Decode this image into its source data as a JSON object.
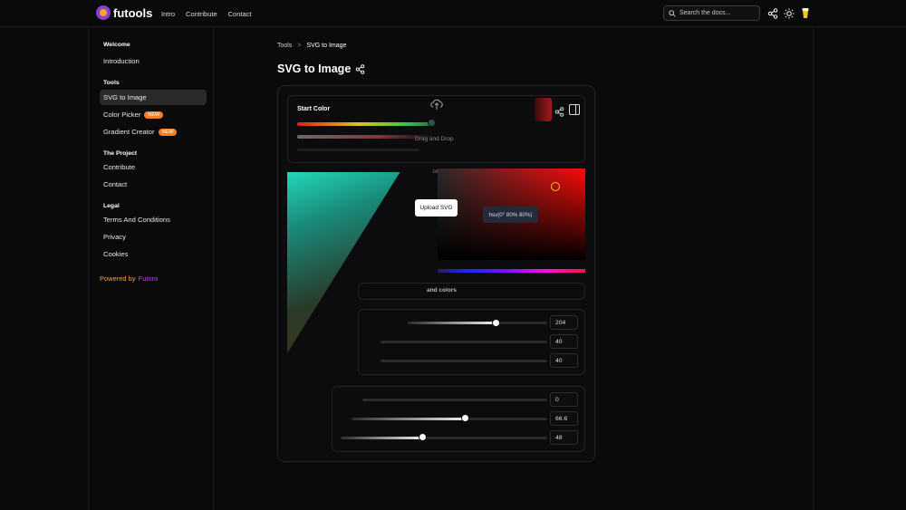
{
  "header": {
    "logo_text": "futools",
    "nav": [
      "Intro",
      "Contribute",
      "Contact"
    ],
    "search_placeholder": "Search the docs...",
    "icons": [
      "share-icon",
      "sun-icon",
      "cup-icon"
    ]
  },
  "sidebar": {
    "sections": [
      {
        "title": "Welcome",
        "items": [
          {
            "label": "Introduction"
          }
        ]
      },
      {
        "title": "Tools",
        "items": [
          {
            "label": "SVG to Image",
            "active": true
          },
          {
            "label": "Color Picker",
            "badge": "NEW"
          },
          {
            "label": "Gradient Creator",
            "badge": "NEW"
          }
        ]
      },
      {
        "title": "The Project",
        "items": [
          {
            "label": "Contribute"
          },
          {
            "label": "Contact"
          }
        ]
      },
      {
        "title": "Legal",
        "items": [
          {
            "label": "Terms And Conditions"
          },
          {
            "label": "Privacy"
          },
          {
            "label": "Cookies"
          }
        ]
      }
    ],
    "powered_prefix": "Powered by",
    "powered_brand": "Futoro"
  },
  "breadcrumb": {
    "parent": "Tools",
    "sep": ">",
    "current": "SVG to Image"
  },
  "page_title": "SVG to Image",
  "picker": {
    "start_color_label": "Start Color",
    "drag_drop": "Drag and Drop",
    "or": "or",
    "upload": "Upload SVG",
    "hsv_tooltip": "hsv(0° 80% 80%)",
    "colors_btn": "and colors",
    "rgb_values": [
      "204",
      "40",
      "40"
    ],
    "second_values": [
      "0",
      "66.6",
      "48"
    ],
    "colors": {
      "swatch": "#cc2828",
      "accent": "#f5a623"
    }
  }
}
